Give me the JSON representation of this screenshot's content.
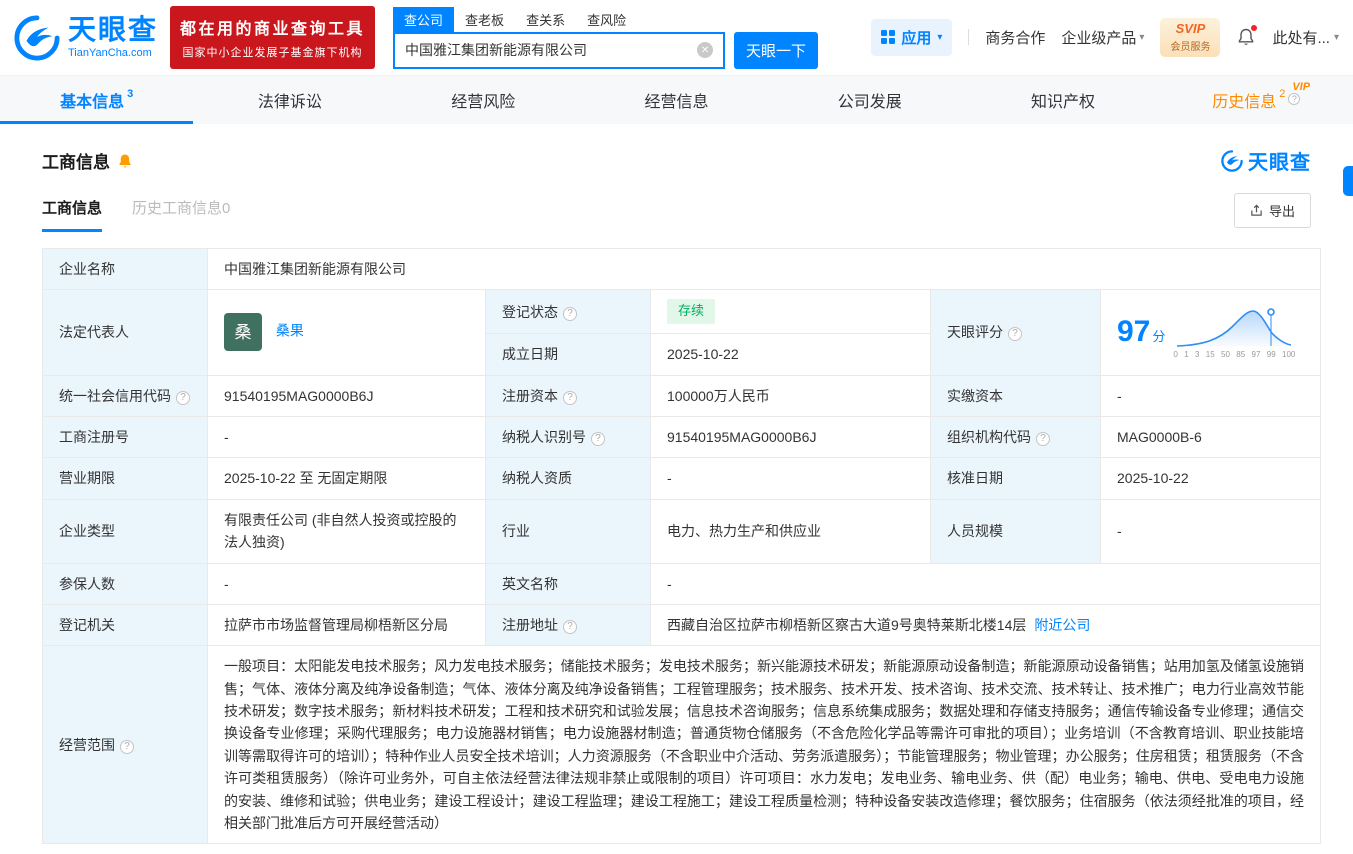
{
  "colors": {
    "primary": "#0084ff",
    "banner_red": "#ca171d",
    "label_bg": "#ebf5fc",
    "status_green": "#00af61",
    "vip_orange": "#ff8a00"
  },
  "icons": {
    "caret_down": "▾",
    "clear": "✕",
    "question": "?"
  },
  "header": {
    "logo": {
      "title": "天眼查",
      "subtitle": "TianYanCha.com"
    },
    "promo": {
      "line1": "都在用的商业查询工具",
      "line2": "国家中小企业发展子基金旗下机构"
    },
    "search": {
      "tabs": [
        {
          "label": "查公司"
        },
        {
          "label": "查老板"
        },
        {
          "label": "查关系"
        },
        {
          "label": "查风险"
        }
      ],
      "value": "中国雅江集团新能源有限公司",
      "button_label": "天眼一下"
    },
    "nav": {
      "apps": "应用",
      "cooperation": "商务合作",
      "enterprise": "企业级产品",
      "svip_line1": "SVIP",
      "svip_line2": "会员服务",
      "user": "此处有..."
    }
  },
  "tabs": [
    {
      "label": "基本信息",
      "badge": "3"
    },
    {
      "label": "法律诉讼"
    },
    {
      "label": "经营风险"
    },
    {
      "label": "经营信息"
    },
    {
      "label": "公司发展"
    },
    {
      "label": "知识产权"
    },
    {
      "label": "历史信息",
      "badge": "2",
      "vip": "VIP"
    }
  ],
  "section": {
    "title": "工商信息",
    "brand": "天眼查",
    "subtabs": [
      {
        "label": "工商信息"
      },
      {
        "label": "历史工商信息0"
      }
    ],
    "export_label": "导出"
  },
  "biz": {
    "company_name_label": "企业名称",
    "company_name": "中国雅江集团新能源有限公司",
    "legal_rep_label": "法定代表人",
    "legal_rep_avatar": "桑",
    "legal_rep_name": "桑果",
    "reg_status_label": "登记状态",
    "reg_status": "存续",
    "establish_label": "成立日期",
    "establish": "2025-10-22",
    "score_label": "天眼评分",
    "credit_code_label": "统一社会信用代码",
    "credit_code": "91540195MAG0000B6J",
    "reg_capital_label": "注册资本",
    "reg_capital": "100000万人民币",
    "paid_capital_label": "实缴资本",
    "paid_capital": "-",
    "reg_number_label": "工商注册号",
    "reg_number": "-",
    "taxpayer_id_label": "纳税人识别号",
    "taxpayer_id": "91540195MAG0000B6J",
    "org_code_label": "组织机构代码",
    "org_code": "MAG0000B-6",
    "business_term_label": "营业期限",
    "business_term": "2025-10-22 至 无固定期限",
    "taxpayer_qual_label": "纳税人资质",
    "taxpayer_qual": "-",
    "approval_date_label": "核准日期",
    "approval_date": "2025-10-22",
    "company_type_label": "企业类型",
    "company_type": "有限责任公司 (非自然人投资或控股的法人独资)",
    "industry_label": "行业",
    "industry": "电力、热力生产和供应业",
    "staff_size_label": "人员规模",
    "staff_size": "-",
    "insured_label": "参保人数",
    "insured": "-",
    "english_name_label": "英文名称",
    "english_name": "-",
    "reg_authority_label": "登记机关",
    "reg_authority": "拉萨市市场监督管理局柳梧新区分局",
    "reg_address_label": "注册地址",
    "reg_address": "西藏自治区拉萨市柳梧新区察古大道9号奥特莱斯北楼14层",
    "nearby_link": "附近公司",
    "business_scope_label": "经营范围",
    "business_scope": "一般项目：太阳能发电技术服务；风力发电技术服务；储能技术服务；发电技术服务；新兴能源技术研发；新能源原动设备制造；新能源原动设备销售；站用加氢及储氢设施销售；气体、液体分离及纯净设备制造；气体、液体分离及纯净设备销售；工程管理服务；技术服务、技术开发、技术咨询、技术交流、技术转让、技术推广；电力行业高效节能技术研发；数字技术服务；新材料技术研发；工程和技术研究和试验发展；信息技术咨询服务；信息系统集成服务；数据处理和存储支持服务；通信传输设备专业修理；通信交换设备专业修理；采购代理服务；电力设施器材销售；电力设施器材制造；普通货物仓储服务（不含危险化学品等需许可审批的项目）；业务培训（不含教育培训、职业技能培训等需取得许可的培训）；特种作业人员安全技术培训；人力资源服务（不含职业中介活动、劳务派遣服务）；节能管理服务；物业管理；办公服务；住房租赁；租赁服务（不含许可类租赁服务）（除许可业务外，可自主依法经营法律法规非禁止或限制的项目）许可项目：水力发电；发电业务、输电业务、供（配）电业务；输电、供电、受电电力设施的安装、维修和试验；供电业务；建设工程设计；建设工程监理；建设工程施工；建设工程质量检测；特种设备安装改造修理；餐饮服务；住宿服务（依法须经批准的项目，经相关部门批准后方可开展经营活动）"
  },
  "score_chart": {
    "type": "line",
    "value": "97",
    "unit": "分",
    "axis": [
      "0",
      "1",
      "3",
      "15",
      "50",
      "85",
      "97",
      "99",
      "100"
    ]
  }
}
